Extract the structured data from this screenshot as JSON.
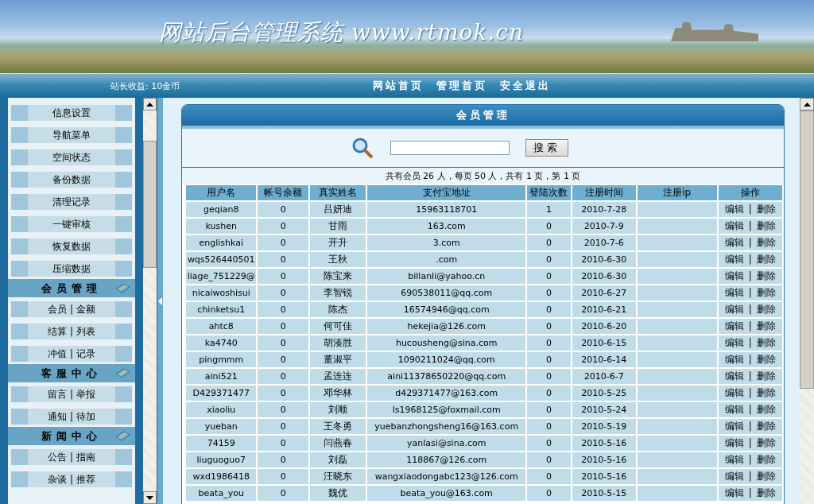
{
  "banner": {
    "title": "网站后台管理系统 www.rtmok.cn"
  },
  "topbar": {
    "earnings": "站长收益: 10金币",
    "links": [
      "网站首页",
      "管理首页",
      "安全退出"
    ]
  },
  "sidebar": {
    "sections": [
      {
        "items": [
          "信息设置",
          "导航菜单",
          "空间状态",
          "备份数据",
          "清理记录",
          "一键审核",
          "恢复数据",
          "压缩数据"
        ]
      },
      {
        "title": "会员管理",
        "items": [
          "会员 | 金额",
          "结算 | 列表",
          "冲值 | 记录"
        ]
      },
      {
        "title": "客服中心",
        "items": [
          "留言 | 举报",
          "通知 | 待加"
        ]
      },
      {
        "title": "新闻中心",
        "items": [
          "公告 | 指南",
          "杂谈 | 推荐"
        ]
      }
    ]
  },
  "panel": {
    "title": "会员管理",
    "search": {
      "button": "搜索"
    },
    "summary": "共有会员 26 人，每页 50 人，共有 1 页，第 1 页"
  },
  "table": {
    "columns": [
      "用户名",
      "帐号余额",
      "真实姓名",
      "支付宝地址",
      "登陆次数",
      "注册时间",
      "注册ip",
      "操作"
    ],
    "rows": [
      {
        "cells": [
          "geqian8",
          "0",
          "吕妍迪",
          "15963118701",
          "1",
          "2010-7-28",
          ""
        ],
        "actions": [
          "编辑",
          "删除"
        ],
        "separator": "|"
      },
      {
        "cells": [
          "kushen",
          "0",
          "甘雨",
          "163.com",
          "0",
          "2010-7-9",
          ""
        ],
        "actions": [
          "编辑",
          "删除"
        ],
        "separator": "|"
      },
      {
        "cells": [
          "englishkai",
          "0",
          "开升",
          "3.com",
          "0",
          "2010-7-6",
          ""
        ],
        "actions": [
          "编辑",
          "删除"
        ],
        "separator": "|"
      },
      {
        "cells": [
          "wqs526440501",
          "0",
          "王秋",
          ".com",
          "0",
          "2010-6-30",
          ""
        ],
        "actions": [
          "编辑",
          "删除"
        ],
        "separator": "|"
      },
      {
        "cells": [
          "liage_751229@",
          "0",
          "陈宝来",
          "billanli@yahoo.cn",
          "0",
          "2010-6-30",
          ""
        ],
        "actions": [
          "编辑",
          "删除"
        ],
        "separator": "|"
      },
      {
        "cells": [
          "nicaiwoshisui",
          "0",
          "李智锐",
          "690538011@qq.com",
          "0",
          "2010-6-27",
          ""
        ],
        "actions": [
          "编辑",
          "删除"
        ],
        "separator": "|"
      },
      {
        "cells": [
          "chinketsu1",
          "0",
          "陈杰",
          "16574946@qq.com",
          "0",
          "2010-6-21",
          ""
        ],
        "actions": [
          "编辑",
          "删除"
        ],
        "separator": "|"
      },
      {
        "cells": [
          "ahtc8",
          "0",
          "何可佳",
          "hekejia@126.com",
          "0",
          "2010-6-20",
          ""
        ],
        "actions": [
          "编辑",
          "删除"
        ],
        "separator": "|"
      },
      {
        "cells": [
          "ka4740",
          "0",
          "胡湊胜",
          "hucousheng@sina.com",
          "0",
          "2010-6-15",
          ""
        ],
        "actions": [
          "编辑",
          "删除"
        ],
        "separator": "|"
      },
      {
        "cells": [
          "pingmmm",
          "0",
          "董淑平",
          "1090211024@qq.com",
          "0",
          "2010-6-14",
          ""
        ],
        "actions": [
          "编辑",
          "删除"
        ],
        "separator": "|"
      },
      {
        "cells": [
          "aini521",
          "0",
          "孟连连",
          "aini11378650220@qq.com",
          "0",
          "2010-6-7",
          ""
        ],
        "actions": [
          "编辑",
          "删除"
        ],
        "separator": "|"
      },
      {
        "cells": [
          "D429371477",
          "0",
          "邓华林",
          "d429371477@163.com",
          "0",
          "2010-5-25",
          ""
        ],
        "actions": [
          "编辑",
          "删除"
        ],
        "separator": "|"
      },
      {
        "cells": [
          "xiaoliu",
          "0",
          "刘顺",
          "ls1968125@foxmail.com",
          "0",
          "2010-5-24",
          ""
        ],
        "actions": [
          "编辑",
          "删除"
        ],
        "separator": "|"
      },
      {
        "cells": [
          "yueban",
          "0",
          "王冬勇",
          "yuebanzhongsheng16@163.com",
          "0",
          "2010-5-19",
          ""
        ],
        "actions": [
          "编辑",
          "删除"
        ],
        "separator": "|"
      },
      {
        "cells": [
          "74159",
          "0",
          "闫燕春",
          "yanlasi@sina.com",
          "0",
          "2010-5-16",
          ""
        ],
        "actions": [
          "编辑",
          "删除"
        ],
        "separator": "|"
      },
      {
        "cells": [
          "liuguoguo7",
          "0",
          "刘磊",
          "118867@126.com",
          "0",
          "2010-5-16",
          ""
        ],
        "actions": [
          "编辑",
          "删除"
        ],
        "separator": "|"
      },
      {
        "cells": [
          "wxd1986418",
          "0",
          "汪晓东",
          "wangxiaodongabc123@126.com",
          "0",
          "2010-5-16",
          ""
        ],
        "actions": [
          "编辑",
          "删除"
        ],
        "separator": "|"
      },
      {
        "cells": [
          "beata_you",
          "0",
          "魏优",
          "beata_you@163.com",
          "0",
          "2010-5-15",
          ""
        ],
        "actions": [
          "编辑",
          "删除"
        ],
        "separator": "|"
      }
    ]
  }
}
